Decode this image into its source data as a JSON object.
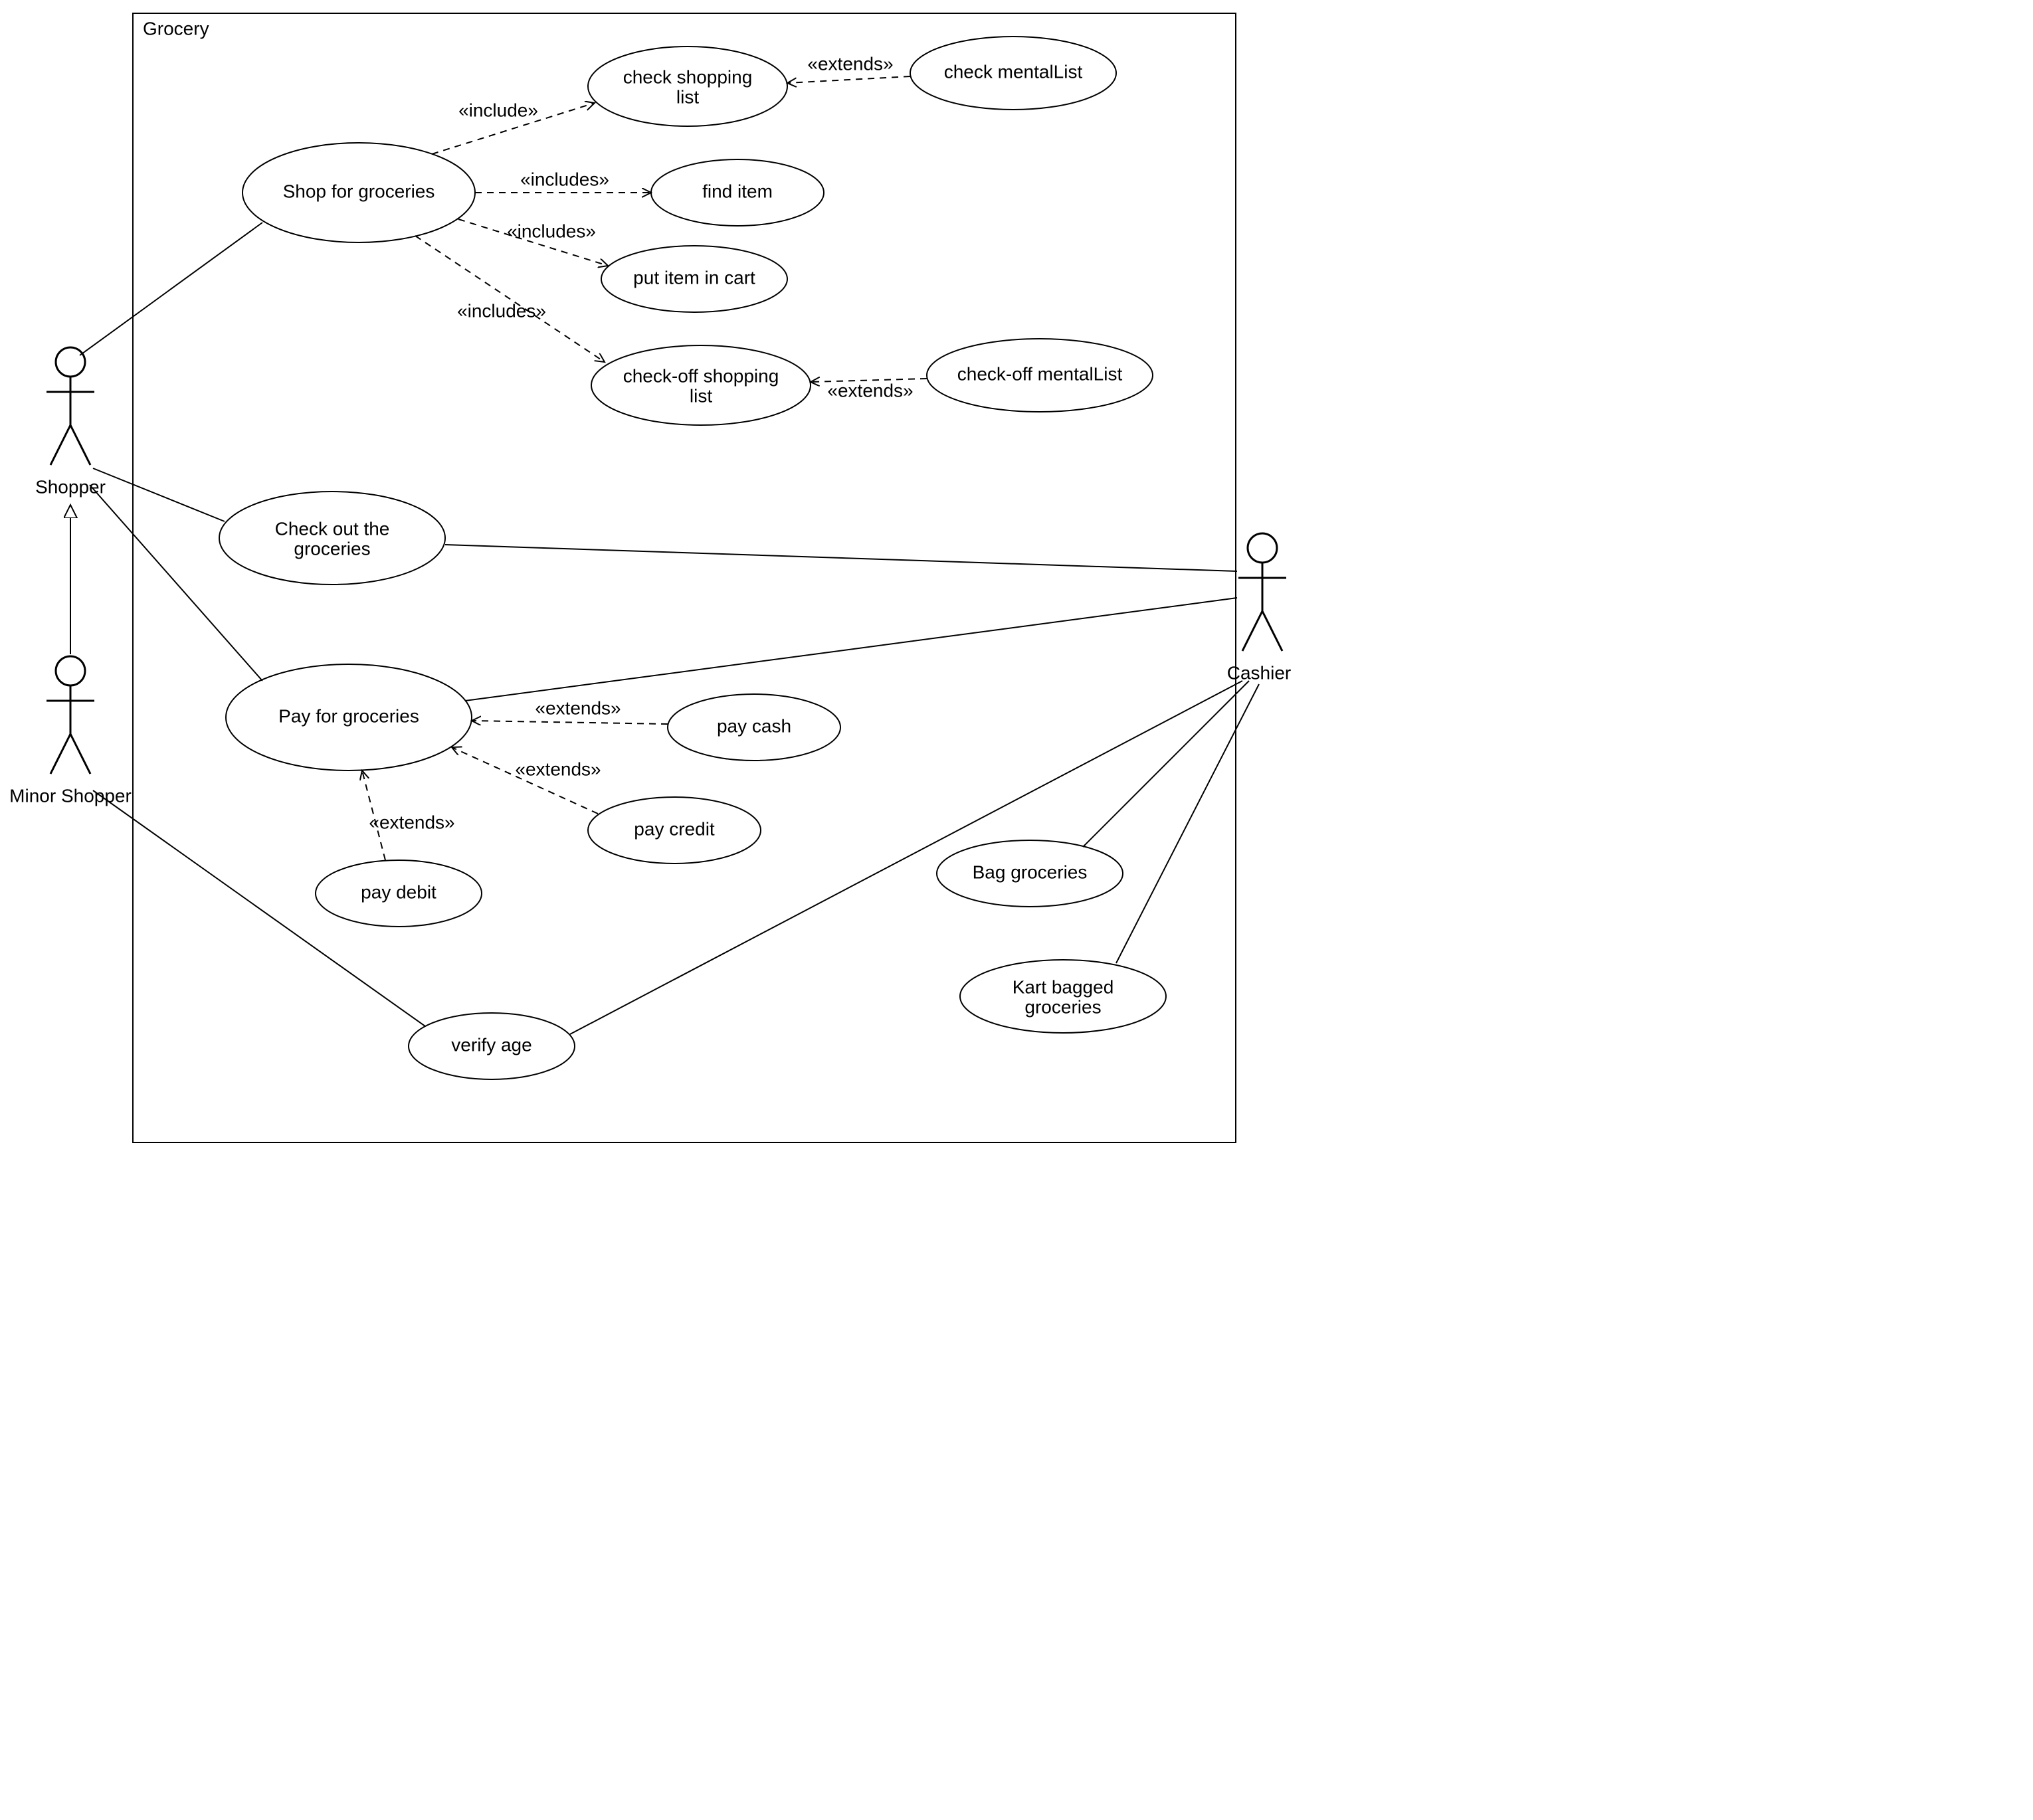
{
  "system": {
    "name": "Grocery"
  },
  "actors": {
    "shopper": "Shopper",
    "minorShopper": "Minor Shopper",
    "cashier": "Cashier"
  },
  "usecases": {
    "shopForGroceries": "Shop for groceries",
    "checkShoppingList": {
      "l1": "check shopping",
      "l2": "list"
    },
    "checkMentalList": "check mentalList",
    "findItem": "find item",
    "putItemInCart": "put item in cart",
    "checkOffShoppingList": {
      "l1": "check-off shopping",
      "l2": "list"
    },
    "checkOffMentalList": "check-off mentalList",
    "checkOutGroceries": {
      "l1": "Check out the",
      "l2": "groceries"
    },
    "payForGroceries": "Pay for groceries",
    "payCash": "pay cash",
    "payCredit": "pay credit",
    "payDebit": "pay debit",
    "bagGroceries": "Bag groceries",
    "kartBagged": {
      "l1": "Kart bagged",
      "l2": "groceries"
    },
    "verifyAge": "verify age"
  },
  "stereotypes": {
    "include": "«include»",
    "includes": "«includes»",
    "extends": "«extends»"
  }
}
